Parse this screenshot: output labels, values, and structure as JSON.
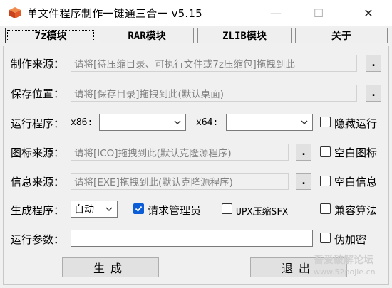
{
  "window": {
    "title": "单文件程序制作一键通三合一 v5.15",
    "min_symbol": "—",
    "max_symbol": "☐",
    "close_symbol": "✕"
  },
  "tabs": [
    {
      "label": "7z模块",
      "active": true
    },
    {
      "label": "RAR模块",
      "active": false
    },
    {
      "label": "ZLIB模块",
      "active": false
    },
    {
      "label": "关于",
      "active": false
    }
  ],
  "form": {
    "source": {
      "label": "制作来源：",
      "placeholder": "请将[待压缩目录、可执行文件或7z压缩包]拖拽到此",
      "browse": "."
    },
    "save": {
      "label": "保存位置：",
      "placeholder": "请将[保存目录]拖拽到此(默认桌面)",
      "browse": "."
    },
    "run": {
      "label": "运行程序：",
      "x86_label": "x86:",
      "x86_value": "",
      "x64_label": "x64:",
      "x64_value": ""
    },
    "hide_run": {
      "label": "隐藏运行",
      "checked": false
    },
    "icon": {
      "label": "图标来源：",
      "placeholder": "请将[ICO]拖拽到此(默认克隆源程序)",
      "browse": ".",
      "blank_label": "空白图标",
      "blank_checked": false
    },
    "info": {
      "label": "信息来源：",
      "placeholder": "请将[EXE]拖拽到此(默认克隆源程序)",
      "browse": ".",
      "blank_label": "空白信息",
      "blank_checked": false
    },
    "gen": {
      "label": "生成程序：",
      "mode_value": "自动",
      "admin_label": "请求管理员",
      "admin_checked": true,
      "upx_label": "UPX压缩SFX",
      "upx_checked": false,
      "compat_label": "兼容算法",
      "compat_checked": false
    },
    "params": {
      "label": "运行参数：",
      "value": "",
      "fake_label": "伪加密",
      "fake_checked": false
    }
  },
  "buttons": {
    "generate": "生成",
    "exit": "退出"
  },
  "watermark": {
    "line1": "吾爱破解论坛",
    "line2": "www.52pojie.cn"
  },
  "colors": {
    "accent": "#0b5cd7",
    "app_icon": "#e25a2a"
  }
}
